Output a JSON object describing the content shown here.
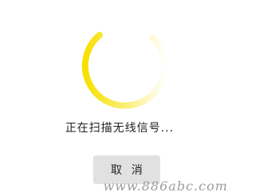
{
  "status": {
    "scanning_text": "正在扫描无线信号..."
  },
  "actions": {
    "cancel_label": "取 消"
  },
  "watermark": {
    "text": "www.886abc.com"
  },
  "colors": {
    "spinner_start": "#f7e000",
    "spinner_end": "#ffffff",
    "button_bg": "#e1e1e1"
  },
  "icons": {
    "spinner": "loading-spinner-icon"
  }
}
